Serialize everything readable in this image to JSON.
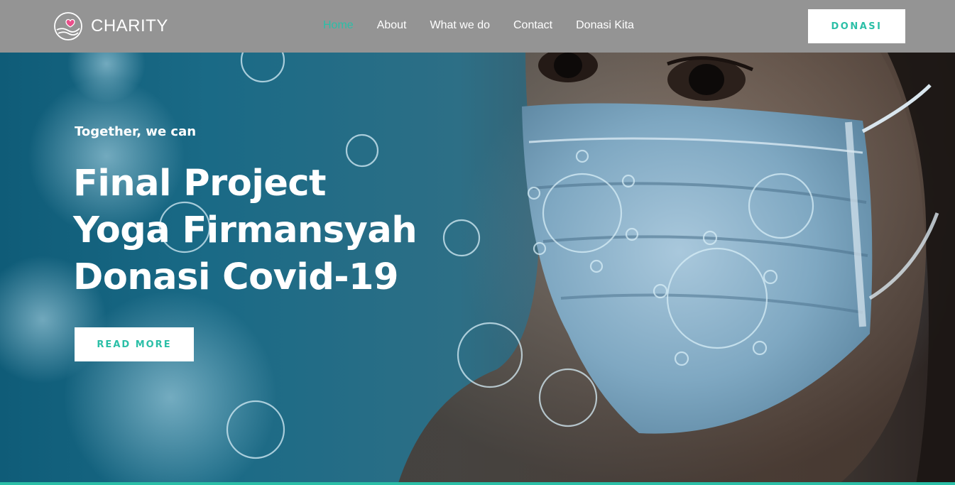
{
  "brand": {
    "name": "CHARITY",
    "logo_icon": "hand-heart-icon",
    "heart_color": "#e94f8a"
  },
  "nav": {
    "items": [
      {
        "label": "Home",
        "active": true
      },
      {
        "label": "About",
        "active": false
      },
      {
        "label": "What we do",
        "active": false
      },
      {
        "label": "Contact",
        "active": false
      },
      {
        "label": "Donasi Kita",
        "active": false
      }
    ],
    "cta_label": "DONASI"
  },
  "hero": {
    "tagline": "Together, we can",
    "title_lines": [
      "Final Project",
      "Yoga Firmansyah",
      "Donasi Covid-19"
    ],
    "button_label": "READ MORE"
  },
  "colors": {
    "accent": "#2bbfa7",
    "navbar": "#949494",
    "hero_blue": "#1a6a86",
    "text": "#ffffff"
  }
}
